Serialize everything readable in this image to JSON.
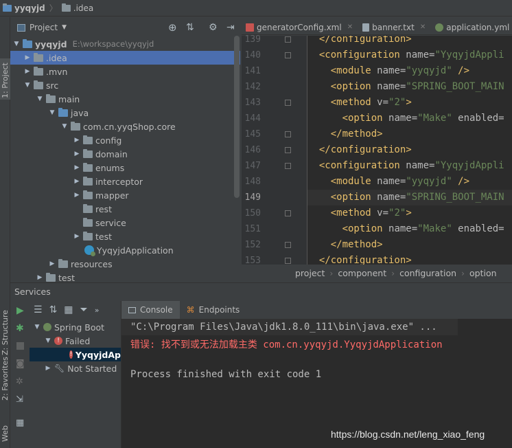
{
  "navbar": {
    "project": "yyqyjd",
    "folder": ".idea"
  },
  "left_strip": {
    "project_tab": "1: Project",
    "structure_tab": "Z: Structure",
    "favorites_tab": "2: Favorites",
    "web_tab": "Web"
  },
  "project_panel": {
    "title": "Project",
    "tree": [
      {
        "label": "yyqyjd",
        "extra": "E:\\workspace\\yyqyjd"
      },
      {
        "label": ".idea"
      },
      {
        "label": ".mvn"
      },
      {
        "label": "src"
      },
      {
        "label": "main"
      },
      {
        "label": "java"
      },
      {
        "label": "com.cn.yyqShop.core"
      },
      {
        "label": "config"
      },
      {
        "label": "domain"
      },
      {
        "label": "enums"
      },
      {
        "label": "interceptor"
      },
      {
        "label": "mapper"
      },
      {
        "label": "rest"
      },
      {
        "label": "service"
      },
      {
        "label": "test"
      },
      {
        "label": "YyqyjdApplication"
      },
      {
        "label": "resources"
      },
      {
        "label": "test"
      }
    ]
  },
  "editor": {
    "tabs": [
      {
        "label": "generatorConfig.xml"
      },
      {
        "label": "banner.txt"
      },
      {
        "label": "application.yml"
      }
    ],
    "lines": [
      {
        "num": "139",
        "indent": "  ",
        "p1": "</configuration>",
        "p2": "",
        "p3": "",
        "p4": ""
      },
      {
        "num": "140",
        "indent": "  ",
        "p1": "<configuration",
        "p2": " name=",
        "p3": "\"YyqyjdAppli",
        "p4": ""
      },
      {
        "num": "141",
        "indent": "    ",
        "p1": "<module",
        "p2": " name=",
        "p3": "\"yyqyjd\"",
        "p4": " />"
      },
      {
        "num": "142",
        "indent": "    ",
        "p1": "<option",
        "p2": " name=",
        "p3": "\"SPRING_BOOT_MAIN",
        "p4": ""
      },
      {
        "num": "143",
        "indent": "    ",
        "p1": "<method",
        "p2": " v=",
        "p3": "\"2\"",
        "p4": ">"
      },
      {
        "num": "144",
        "indent": "      ",
        "p1": "<option",
        "p2": " name=",
        "p3": "\"Make\"",
        "p4": " enabled="
      },
      {
        "num": "145",
        "indent": "    ",
        "p1": "</method>",
        "p2": "",
        "p3": "",
        "p4": ""
      },
      {
        "num": "146",
        "indent": "  ",
        "p1": "</configuration>",
        "p2": "",
        "p3": "",
        "p4": ""
      },
      {
        "num": "147",
        "indent": "  ",
        "p1": "<configuration",
        "p2": " name=",
        "p3": "\"YyqyjdAppli",
        "p4": ""
      },
      {
        "num": "148",
        "indent": "    ",
        "p1": "<module",
        "p2": " name=",
        "p3": "\"yyqyjd\"",
        "p4": " />"
      },
      {
        "num": "149",
        "indent": "    ",
        "p1": "<option",
        "p2": " name=",
        "p3": "\"SPRING_BOOT_MAIN",
        "p4": ""
      },
      {
        "num": "150",
        "indent": "    ",
        "p1": "<method",
        "p2": " v=",
        "p3": "\"2\"",
        "p4": ">"
      },
      {
        "num": "151",
        "indent": "      ",
        "p1": "<option",
        "p2": " name=",
        "p3": "\"Make\"",
        "p4": " enabled="
      },
      {
        "num": "152",
        "indent": "    ",
        "p1": "</method>",
        "p2": "",
        "p3": "",
        "p4": ""
      },
      {
        "num": "153",
        "indent": "  ",
        "p1": "</configuration>",
        "p2": "",
        "p3": "",
        "p4": ""
      }
    ],
    "breadcrumb": [
      "project",
      "component",
      "configuration",
      "option"
    ]
  },
  "services": {
    "title": "Services",
    "tree": [
      {
        "label": "Spring Boot"
      },
      {
        "label": "Failed"
      },
      {
        "label": "YyqyjdAp"
      },
      {
        "label": "Not Started"
      }
    ],
    "tabs": [
      {
        "label": "Console"
      },
      {
        "label": "Endpoints"
      }
    ],
    "console": {
      "cmd": "\"C:\\Program Files\\Java\\jdk1.8.0_111\\bin\\java.exe\" ...",
      "error": "错误: 找不到或无法加载主类 com.cn.yyqyjd.YyqyjdApplication",
      "exit": "Process finished with exit code 1"
    }
  },
  "watermark": "https://blog.csdn.net/leng_xiao_feng",
  "colors": {
    "selection": "#4b6eaf",
    "error": "#ff6b68",
    "tag": "#e8bf6a",
    "string": "#6a8759"
  }
}
